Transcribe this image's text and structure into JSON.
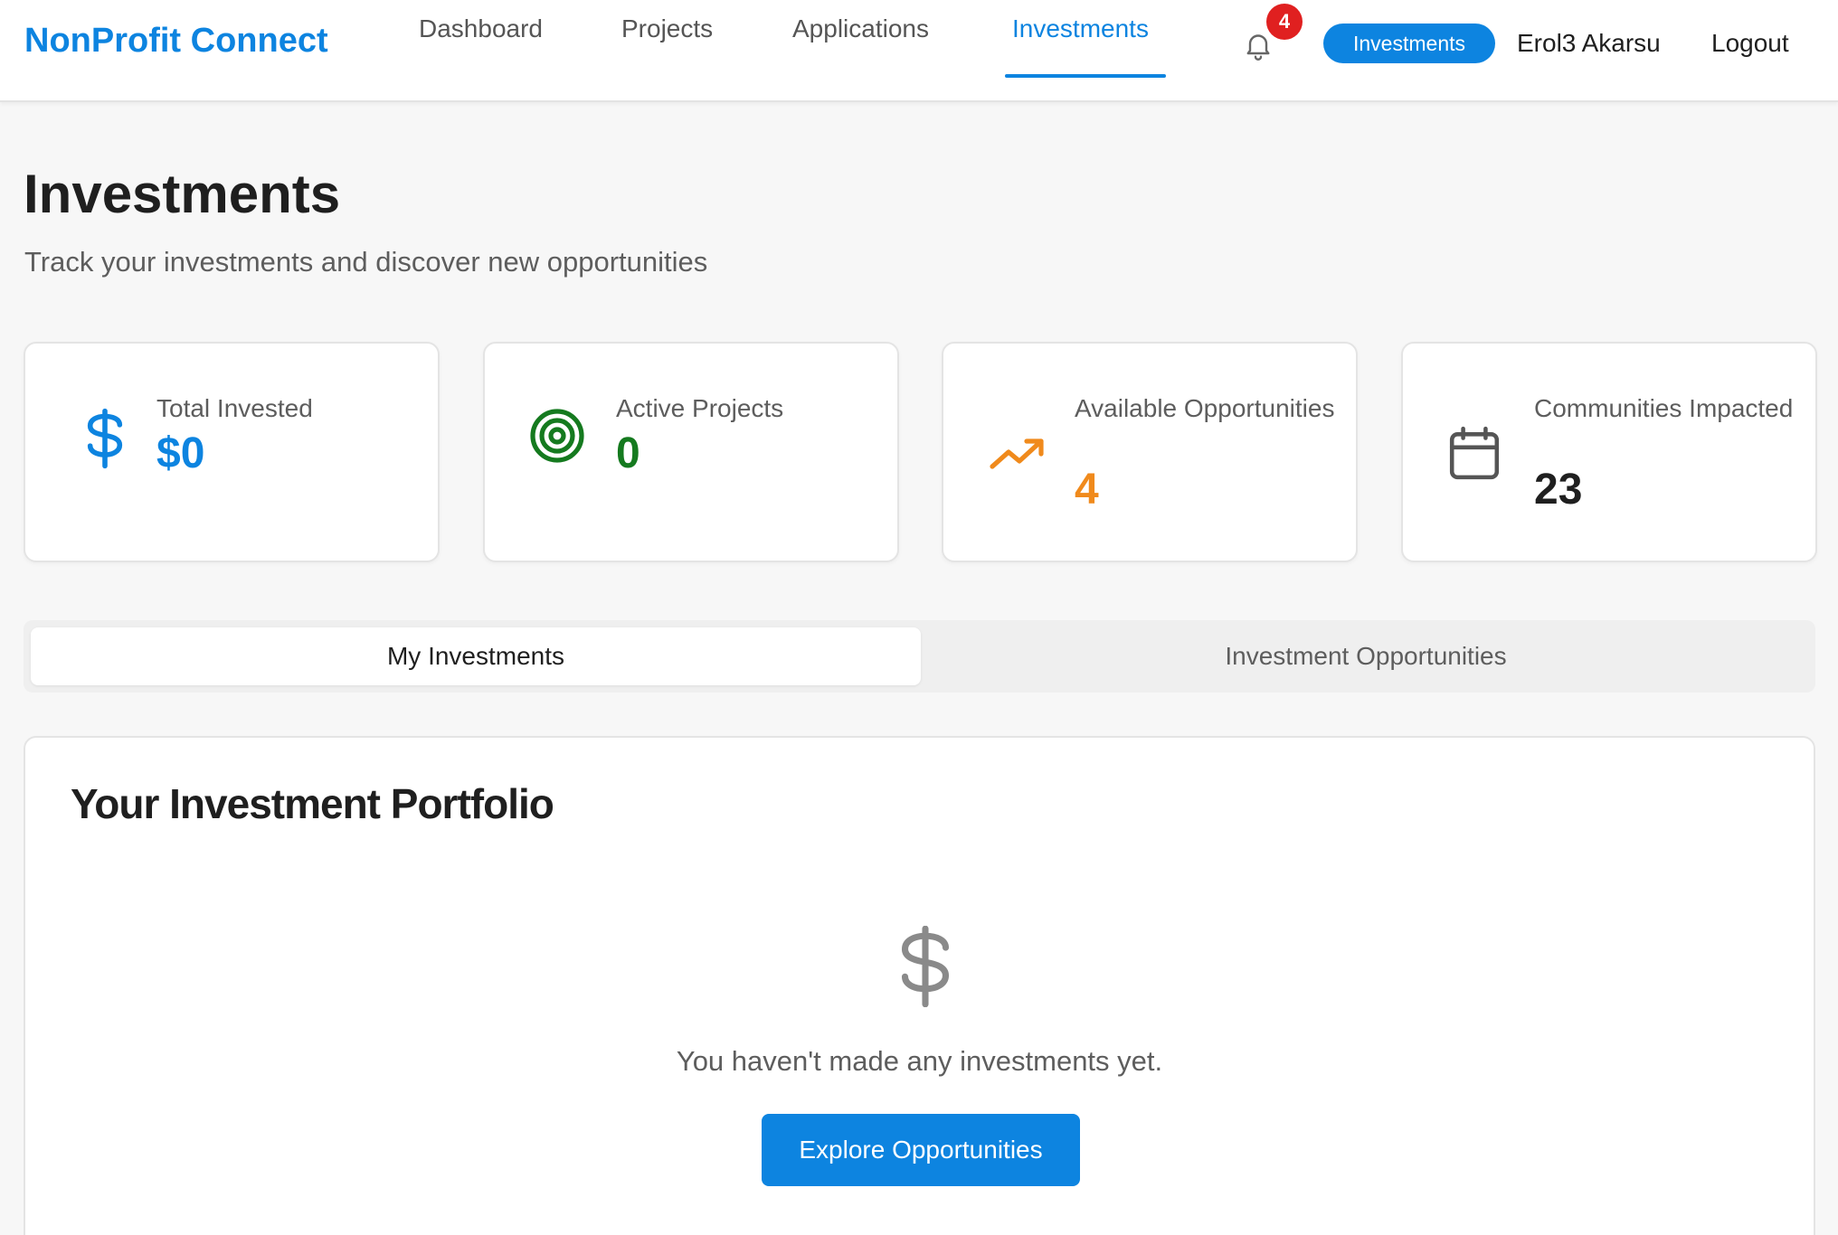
{
  "app": {
    "brand": "NonProfit Connect"
  },
  "nav": {
    "links": [
      {
        "label": "Dashboard"
      },
      {
        "label": "Projects"
      },
      {
        "label": "Applications"
      },
      {
        "label": "Investments"
      }
    ],
    "active": "Investments",
    "notifications_count": "4",
    "role_pill": "Investments",
    "user_name": "Erol3 Akarsu",
    "logout_label": "Logout"
  },
  "header": {
    "title": "Investments",
    "subtitle": "Track your investments and discover new opportunities"
  },
  "stats": [
    {
      "label": "Total Invested",
      "value": "$0",
      "icon": "dollar-icon",
      "color": "#0d84e0"
    },
    {
      "label": "Active Projects",
      "value": "0",
      "icon": "target-icon",
      "color": "#157a1f"
    },
    {
      "label": "Available Opportunities",
      "value": "4",
      "icon": "trending-up-icon",
      "color": "#f08a1c"
    },
    {
      "label": "Communities Impacted",
      "value": "23",
      "icon": "calendar-icon",
      "color": "#1f1f1f"
    }
  ],
  "tabs": [
    {
      "label": "My Investments",
      "active": true
    },
    {
      "label": "Investment Opportunities",
      "active": false
    }
  ],
  "portfolio": {
    "title": "Your Investment Portfolio",
    "empty_icon": "dollar-icon",
    "empty_text": "You haven't made any investments yet.",
    "cta_label": "Explore Opportunities"
  },
  "colors": {
    "accent": "#0d84e0",
    "badge": "#e02020"
  }
}
